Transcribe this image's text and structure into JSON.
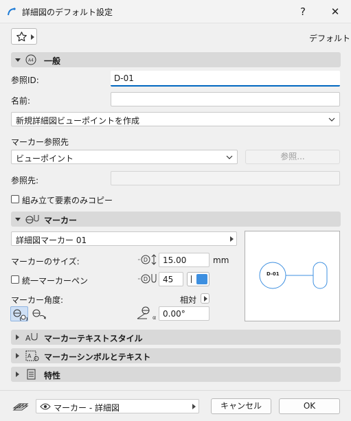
{
  "window": {
    "title": "詳細図のデフォルト設定",
    "help": "?",
    "close": "✕"
  },
  "toolbar": {
    "favorites_icon": "star-icon",
    "default_label": "デフォルト"
  },
  "general": {
    "header": "一般",
    "ref_id_label": "参照ID:",
    "ref_id_value": "D-01",
    "name_label": "名前:",
    "name_value": "",
    "new_viewpoint_option": "新規詳細図ビューポイントを作成",
    "marker_ref_label": "マーカー参照先",
    "marker_ref_value": "ビューポイント",
    "browse_button": "参照...",
    "ref_dest_label": "参照先:",
    "ref_dest_value": "",
    "copy_assembly_label": "組み立て要素のみコピー",
    "copy_assembly_checked": false
  },
  "marker": {
    "header": "マーカー",
    "type_value": "詳細図マーカー 01",
    "size_label": "マーカーのサイズ:",
    "size_value": "15.00",
    "size_unit": "mm",
    "uniform_pen_label": "統一マーカーペン",
    "uniform_pen_checked": false,
    "pen_value": "45",
    "pen_color": "#3d8fe0",
    "angle_label": "マーカー角度:",
    "angle_mode": "相対",
    "angle_value": "0.00°",
    "preview_label": "D-01"
  },
  "sections": {
    "text_style": "マーカーテキストスタイル",
    "symbol_text": "マーカーシンボルとテキスト",
    "properties": "特性"
  },
  "footer": {
    "layer_value": "マーカー - 詳細図",
    "cancel_button": "キャンセル",
    "ok_button": "OK"
  },
  "colors": {
    "accent": "#0067c0",
    "section_bg": "#d9d9d9",
    "dialog_bg": "#f0f0f0"
  }
}
